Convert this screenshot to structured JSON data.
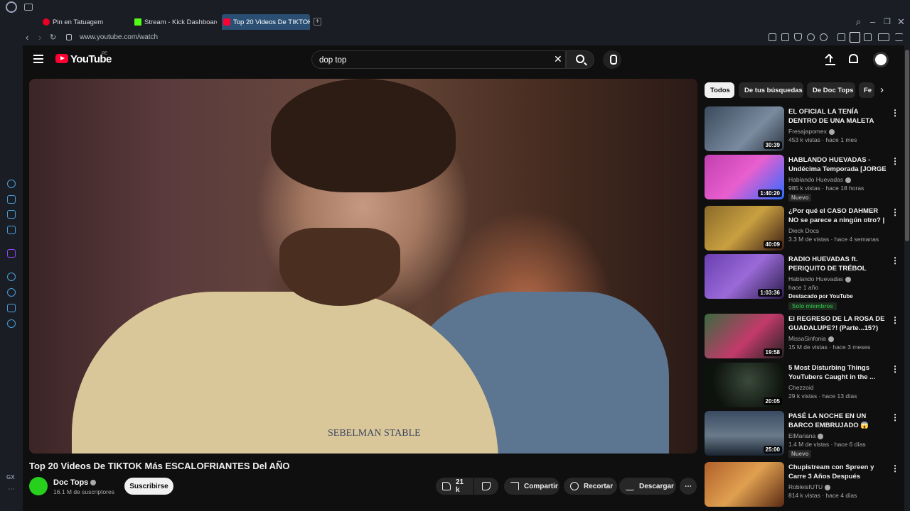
{
  "browser": {
    "tabs": [
      {
        "label": "Pin en Tatuagem"
      },
      {
        "label": "Stream - Kick Dashboard"
      },
      {
        "label": "Top 20 Videos De TIKTOK"
      }
    ],
    "url": "www.youtube.com/watch",
    "sidebar_label": "GX",
    "sidebar_more": "⋯"
  },
  "masthead": {
    "logo_text": "YouTube",
    "country": "PE",
    "search_value": "dop top",
    "clear": "✕"
  },
  "video": {
    "title": "Top 20 Videos De TIKTOK Más ESCALOFRIANTES Del AÑO",
    "shirt_print": "SEBELMAN STABLE",
    "channel": "Doc Tops",
    "subscribers": "16.1 M de suscriptores",
    "subscribe_label": "Suscribirse",
    "likes": "21 k",
    "share_label": "Compartir",
    "clip_label": "Recortar",
    "download_label": "Descargar",
    "more": "⋯"
  },
  "chips": [
    {
      "label": "Todos"
    },
    {
      "label": "De tus búsquedas"
    },
    {
      "label": "De Doc Tops"
    },
    {
      "label": "Fe"
    }
  ],
  "chip_next": "›",
  "recommendations": [
    {
      "title": "EL OFICIAL LA TENÍA DENTRO DE UNA MALETA POR DÍAS",
      "channel": "Fresajapomex",
      "meta": "453 k vistas · hace 1 mes",
      "duration": "30:39",
      "color": "#3b4a5c"
    },
    {
      "title": "HABLANDO HUEVADAS - Undécima Temporada [JORGE ...",
      "channel": "Hablando Huevadas",
      "meta": "985 k vistas · hace 18 horas",
      "duration": "1:40:20",
      "badge": "Nuevo",
      "color": "#c23fb0"
    },
    {
      "title": "¿Por qué el CASO DAHMER NO se parece a ningún otro? | ...",
      "channel": "Dieck Docs",
      "meta": "3.3 M de vistas · hace 4 semanas",
      "duration": "40:09",
      "color": "#8a6a2a"
    },
    {
      "title": "RADIO HUEVADAS ft. PERIQUITO DE TRÉBOL CLAN",
      "channel": "Hablando Huevadas",
      "meta": "hace 1 año",
      "duration": "1:03:36",
      "featured": "Destacado por YouTube",
      "members": "Solo miembros",
      "color": "#6a3fb0"
    },
    {
      "title": "El REGRESO DE LA ROSA DE GUADALUPE?! (Parte...15?)",
      "channel": "MissaSinfonia",
      "meta": "15 M de vistas · hace 3 meses",
      "duration": "19:58",
      "color": "#3a6a40"
    },
    {
      "title": "5 Most Disturbing Things YouTubers Caught in the ...",
      "channel": "Chezzoid",
      "meta": "29 k vistas · hace 13 días",
      "duration": "20:05",
      "color": "#1a2018"
    },
    {
      "title": "PASÉ LA NOCHE EN UN BARCO EMBRUJADO 😱",
      "channel": "ElMariana",
      "meta": "1.4 M de vistas · hace 6 días",
      "duration": "25:00",
      "badge": "Nuevo",
      "color": "#3a4a62"
    },
    {
      "title": "Chupistream con Spreen y Carre 3 Años Después",
      "channel": "RobleisIUTU",
      "meta": "814 k vistas · hace 4 días",
      "duration": "",
      "color": "#b0602a"
    }
  ],
  "colors": {
    "brand": "#ff0033",
    "accent": "#2a4f73",
    "channel_avatar": "#28d01e"
  }
}
